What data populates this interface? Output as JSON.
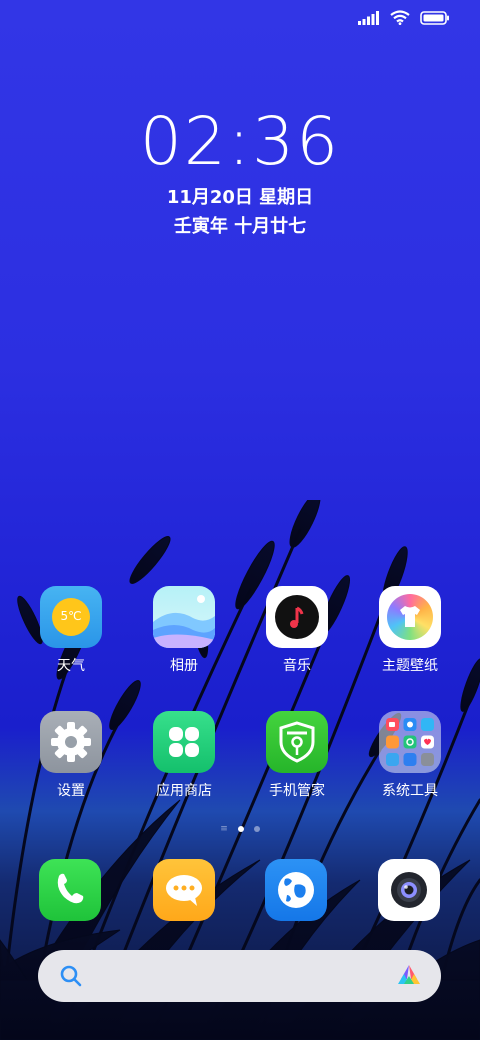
{
  "status_bar": {
    "icons": [
      "signal-icon",
      "wifi-icon",
      "battery-icon"
    ]
  },
  "clock": {
    "time": "02:36",
    "date": "11月20日  星期日",
    "lunar": "壬寅年  十月廿七"
  },
  "apps": [
    {
      "name": "天气",
      "icon": "weather-icon",
      "badge": "5℃"
    },
    {
      "name": "相册",
      "icon": "gallery-icon"
    },
    {
      "name": "音乐",
      "icon": "music-icon"
    },
    {
      "name": "主题壁纸",
      "icon": "themes-icon"
    },
    {
      "name": "设置",
      "icon": "settings-gear-icon"
    },
    {
      "name": "应用商店",
      "icon": "app-store-icon"
    },
    {
      "name": "手机管家",
      "icon": "security-shield-icon"
    },
    {
      "name": "系统工具",
      "icon": "system-tools-folder-icon"
    }
  ],
  "page_indicator": {
    "pages": 2,
    "active": 1
  },
  "dock": [
    {
      "icon": "phone-icon"
    },
    {
      "icon": "messages-icon"
    },
    {
      "icon": "browser-globe-icon"
    },
    {
      "icon": "camera-icon"
    }
  ],
  "search": {
    "icon": "search-icon",
    "assistant_icon": "assistant-icon"
  },
  "colors": {
    "sky_top": "#3236e6",
    "sky_mid": "#2225d7",
    "horizon_glow": "#1f4ab0",
    "grass": "#06091c"
  }
}
